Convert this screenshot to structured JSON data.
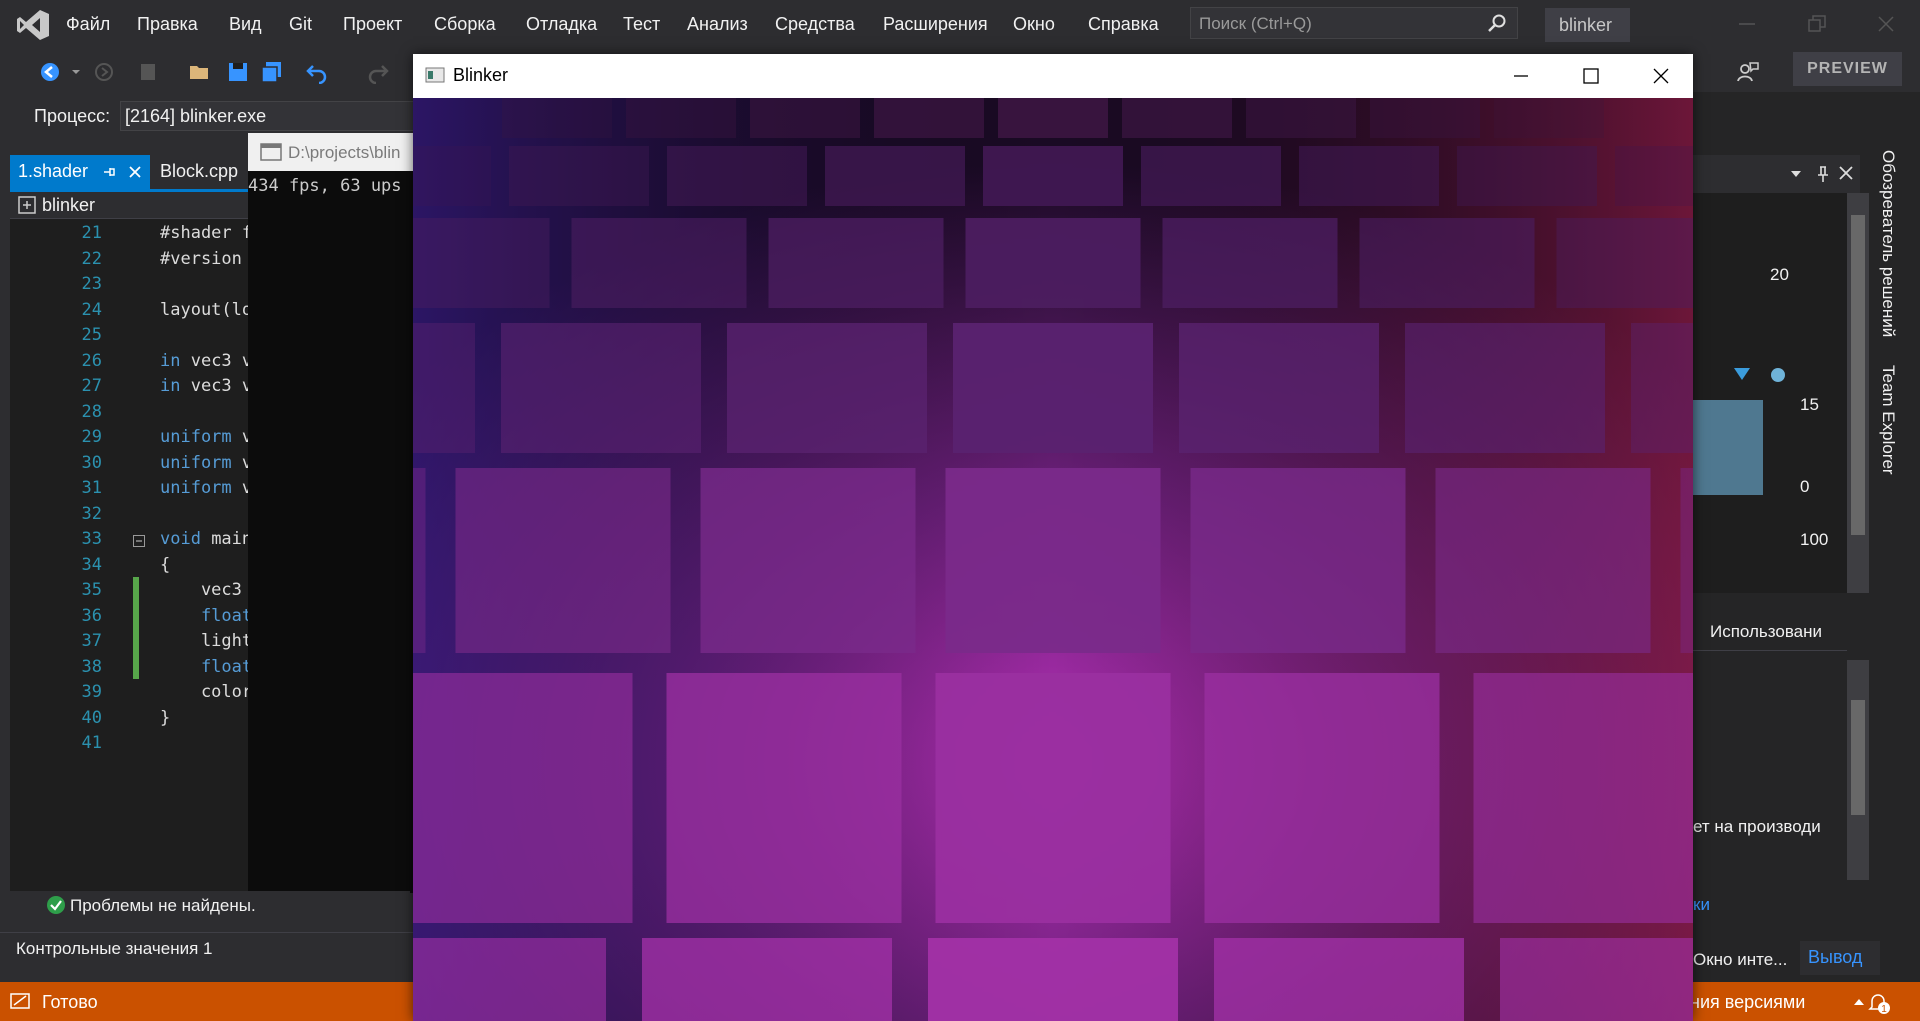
{
  "menubar": {
    "items": [
      "Файл",
      "Правка",
      "Вид",
      "Git",
      "Проект",
      "Сборка",
      "Отладка",
      "Тест",
      "Анализ",
      "Средства",
      "Расширения",
      "Окно",
      "Справка"
    ],
    "search_placeholder": "Поиск (Ctrl+Q)",
    "solution_name": "blinker"
  },
  "toolbar": {
    "preview_label": "PREVIEW"
  },
  "process": {
    "label": "Процесс:",
    "value": "[2164] blinker.exe"
  },
  "tabs": [
    {
      "label": "1.shader",
      "active": true
    },
    {
      "label": "Block.cpp",
      "active": false
    }
  ],
  "editor": {
    "nav_scope": "blinker",
    "lines": [
      {
        "n": "21",
        "text": "#shader f"
      },
      {
        "n": "22",
        "text": "#version "
      },
      {
        "n": "23",
        "text": ""
      },
      {
        "n": "24",
        "text": "layout(lo"
      },
      {
        "n": "25",
        "text": ""
      },
      {
        "n": "26",
        "kw": "in",
        "text": " vec3 v"
      },
      {
        "n": "27",
        "kw": "in",
        "text": " vec3 v"
      },
      {
        "n": "28",
        "text": ""
      },
      {
        "n": "29",
        "kw": "uniform",
        "text": " v"
      },
      {
        "n": "30",
        "kw": "uniform",
        "text": " v"
      },
      {
        "n": "31",
        "kw": "uniform",
        "text": " v"
      },
      {
        "n": "32",
        "text": ""
      },
      {
        "n": "33",
        "kw": "void",
        "text": " main"
      },
      {
        "n": "34",
        "text": "{"
      },
      {
        "n": "35",
        "text": "    vec3 "
      },
      {
        "n": "36",
        "kw": "    float",
        "text": ""
      },
      {
        "n": "37",
        "text": "    light"
      },
      {
        "n": "38",
        "kw": "    float",
        "text": ""
      },
      {
        "n": "39",
        "text": "    color"
      },
      {
        "n": "40",
        "text": "}"
      },
      {
        "n": "41",
        "text": ""
      }
    ]
  },
  "console": {
    "title": "D:\\projects\\blin",
    "output": "434 fps, 63 ups"
  },
  "status": {
    "problems": "Проблемы не найдены.",
    "watch": "Контрольные значения 1",
    "ready": "Готово",
    "version_control": "ния версиями",
    "notification_count": "1"
  },
  "right_panel": {
    "vtab_solution": "Обозреватель решений",
    "vtab_team": "Team Explorer",
    "value_20": "20",
    "value_15": "15",
    "value_0": "0",
    "value_100": "100",
    "usage_label": "Использовани",
    "perf_label": "ет на производи",
    "link_label": "ки",
    "interactive_label": "Окно инте...",
    "output_tab": "Вывод"
  },
  "blinker_window": {
    "title": "Blinker"
  },
  "colors": {
    "accent": "#007acc",
    "status_bar": "#ca5100",
    "cube_base": "#9a2fa0"
  }
}
